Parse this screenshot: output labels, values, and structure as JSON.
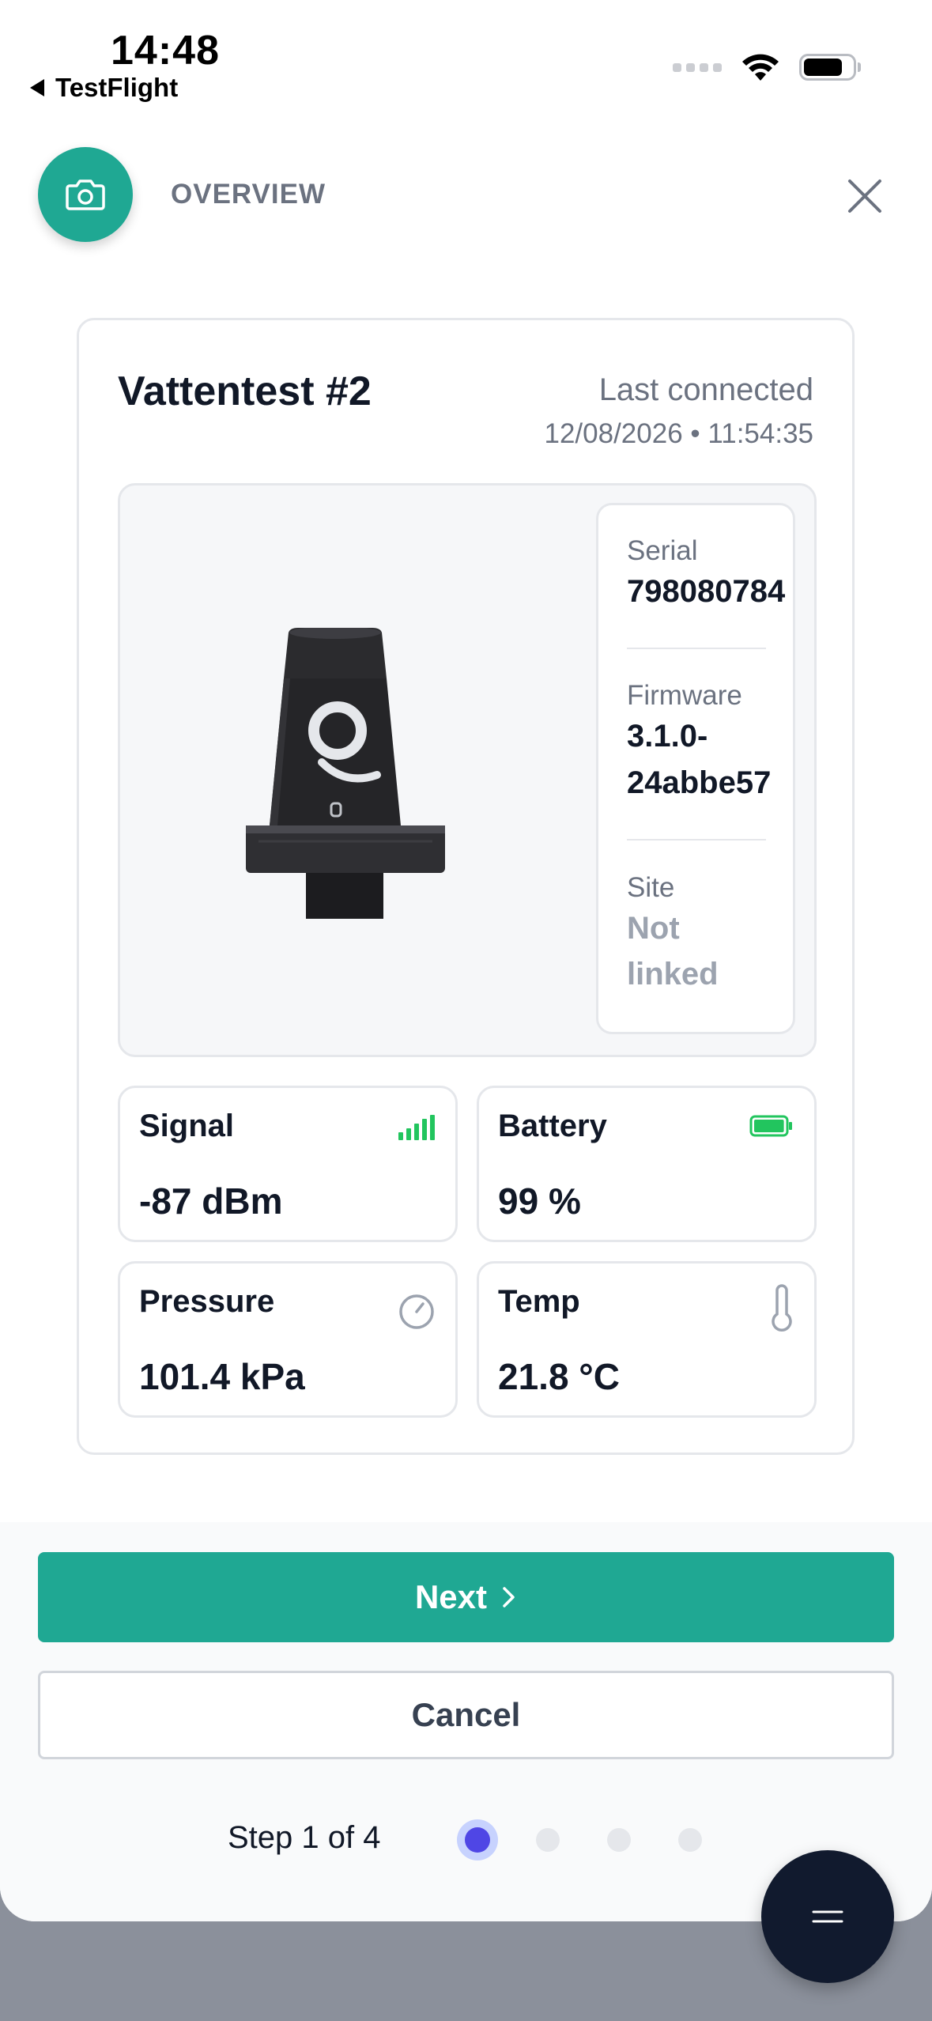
{
  "status_bar": {
    "time": "14:48",
    "back_app": "TestFlight"
  },
  "header": {
    "title": "OVERVIEW",
    "camera_icon": "camera-icon",
    "close_icon": "close-icon"
  },
  "device": {
    "name": "Vattentest #2",
    "last_connected_label": "Last connected",
    "last_connected_value": "12/08/2026 • 11:54:35",
    "serial_label": "Serial",
    "serial_value": "798080784",
    "firmware_label": "Firmware",
    "firmware_value_line1": "3.1.0-",
    "firmware_value_line2": "24abbe57",
    "site_label": "Site",
    "site_value_line1": "Not",
    "site_value_line2": "linked"
  },
  "metrics": {
    "signal": {
      "label": "Signal",
      "value": "-87 dBm",
      "icon": "signal-bars-icon"
    },
    "battery": {
      "label": "Battery",
      "value": "99 %",
      "icon": "battery-icon",
      "level": 0.99
    },
    "pressure": {
      "label": "Pressure",
      "value": "101.4 kPa",
      "icon": "gauge-icon"
    },
    "temp": {
      "label": "Temp",
      "value": "21.8 °C",
      "icon": "thermometer-icon"
    }
  },
  "actions": {
    "next_label": "Next",
    "cancel_label": "Cancel"
  },
  "stepper": {
    "text": "Step 1 of 4",
    "current": 1,
    "total": 4
  },
  "colors": {
    "accent": "#1fa893",
    "step_active": "#4f46e5",
    "signal_green": "#22c55e",
    "fab": "#111a2e"
  }
}
